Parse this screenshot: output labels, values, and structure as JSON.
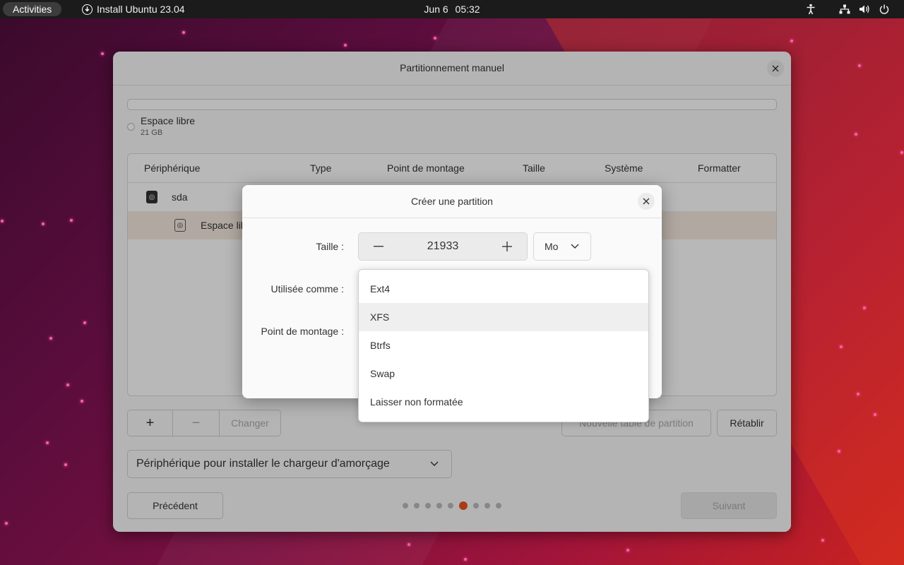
{
  "topbar": {
    "activities": "Activities",
    "app_title": "Install Ubuntu 23.04",
    "date": "Jun 6",
    "time": "05:32"
  },
  "window": {
    "title": "Partitionnement manuel",
    "free_space_label": "Espace libre",
    "free_space_size": "21 GB",
    "table": {
      "headers": [
        "Périphérique",
        "Type",
        "Point de montage",
        "Taille",
        "Système",
        "Formatter"
      ],
      "rows": [
        {
          "device": "sda"
        },
        {
          "device": "Espace libre"
        }
      ]
    },
    "add_label": "+",
    "remove_label": "−",
    "change_label": "Changer",
    "new_table_label": "Nouvelle table de partition",
    "revert_label": "Rétablir",
    "boot_device_label": "Périphérique pour installer le chargeur d'amorçage",
    "back_label": "Précédent",
    "next_label": "Suivant",
    "steps_total": 9,
    "step_active": 6
  },
  "dialog": {
    "title": "Créer une partition",
    "size_label": "Taille :",
    "size_value": "21933",
    "unit_value": "Mo",
    "use_as_label": "Utilisée comme :",
    "mount_label": "Point de montage :",
    "filesystem_options": [
      "Ext4",
      "XFS",
      "Btrfs",
      "Swap",
      "Laisser non formatée"
    ],
    "hovered_option": "XFS"
  },
  "colors": {
    "accent": "#e95420",
    "selected_row": "#f6ebe0"
  }
}
